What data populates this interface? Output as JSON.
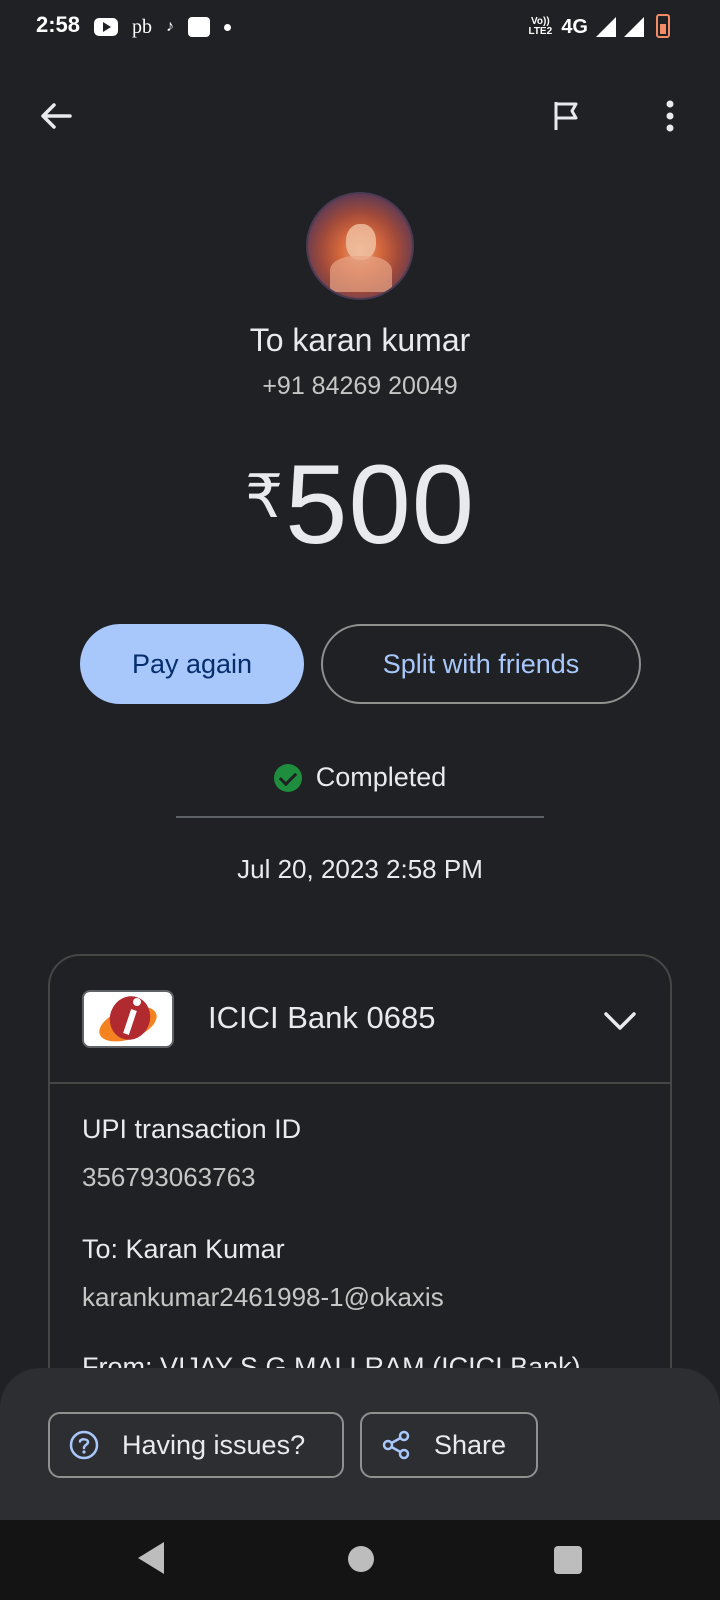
{
  "status_bar": {
    "time": "2:58",
    "pb_label": "pb",
    "network_top": "Vo))",
    "network_bottom": "LTE2",
    "network_type": "4G",
    "icons": [
      "youtube-icon",
      "pb-icon",
      "tiktok-icon",
      "paytm-icon",
      "dot-icon",
      "signal-icon",
      "battery-icon"
    ]
  },
  "app_bar": {
    "icons": [
      "back-arrow-icon",
      "flag-icon",
      "more-vert-icon"
    ]
  },
  "payee": {
    "name": "To karan kumar",
    "phone": "+91 84269 20049"
  },
  "amount": {
    "currency": "₹",
    "value": "500"
  },
  "actions": {
    "pay_again": "Pay again",
    "split": "Split with friends"
  },
  "status": {
    "text": "Completed",
    "color": "#1e8e3e",
    "datetime": "Jul 20, 2023 2:58 PM"
  },
  "details": {
    "bank_name": "ICICI Bank 0685",
    "txn_label": "UPI transaction ID",
    "txn_value": "356793063763",
    "to_label": "To: Karan Kumar",
    "to_value": "karankumar2461998-1@okaxis",
    "from_label_partial": "From: VIJAY S G MALLRAM (ICICI Bank)"
  },
  "bottom_actions": {
    "issues": "Having issues?",
    "share": "Share"
  },
  "colors": {
    "background": "#202124",
    "accent": "#a8c7fa",
    "sheet": "#2d2e31"
  }
}
